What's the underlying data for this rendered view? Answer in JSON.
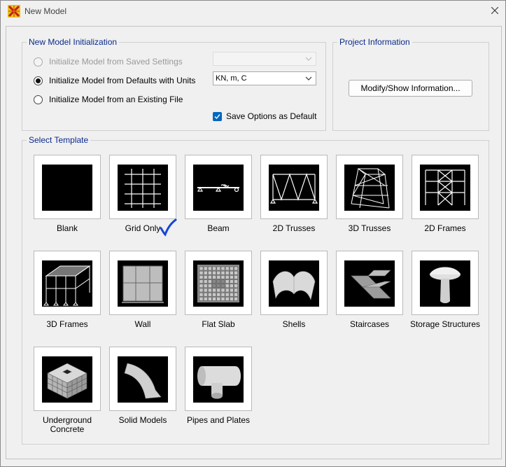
{
  "window": {
    "title": "New Model"
  },
  "init_group": {
    "label": "New Model Initialization",
    "options": [
      {
        "label": "Initialize Model from Saved Settings",
        "checked": false,
        "disabled": true
      },
      {
        "label": "Initialize Model from Defaults with Units",
        "checked": true,
        "disabled": false
      },
      {
        "label": "Initialize Model from an Existing File",
        "checked": false,
        "disabled": false
      }
    ],
    "saved_settings_value": "",
    "units_value": "KN, m, C",
    "save_default": {
      "label": "Save Options as Default",
      "checked": true
    }
  },
  "project_group": {
    "label": "Project Information",
    "button_label": "Modify/Show Information..."
  },
  "template_group": {
    "label": "Select Template",
    "templates": [
      {
        "label": "Blank",
        "icon": "blank-icon"
      },
      {
        "label": "Grid Only",
        "icon": "grid-icon"
      },
      {
        "label": "Beam",
        "icon": "beam-icon"
      },
      {
        "label": "2D Trusses",
        "icon": "truss-2d-icon"
      },
      {
        "label": "3D Trusses",
        "icon": "truss-3d-icon"
      },
      {
        "label": "2D Frames",
        "icon": "frame-2d-icon"
      },
      {
        "label": "3D Frames",
        "icon": "frame-3d-icon"
      },
      {
        "label": "Wall",
        "icon": "wall-icon"
      },
      {
        "label": "Flat Slab",
        "icon": "flat-slab-icon"
      },
      {
        "label": "Shells",
        "icon": "shells-icon"
      },
      {
        "label": "Staircases",
        "icon": "staircase-icon"
      },
      {
        "label": "Storage Structures",
        "icon": "storage-structure-icon"
      },
      {
        "label": "Underground\nConcrete",
        "icon": "underground-concrete-icon"
      },
      {
        "label": "Solid Models",
        "icon": "solid-model-icon"
      },
      {
        "label": "Pipes and Plates",
        "icon": "pipes-plates-icon"
      }
    ]
  },
  "annotation": {
    "icon": "handwritten-checkmark-icon",
    "color": "#1846d8"
  }
}
